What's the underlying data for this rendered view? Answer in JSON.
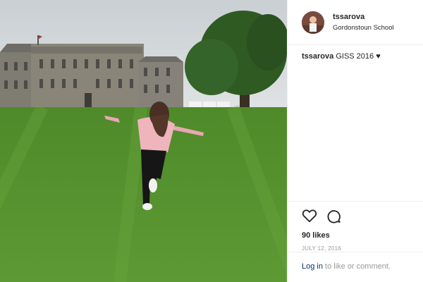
{
  "post": {
    "username": "tssarova",
    "location": "Gordonstoun School",
    "caption_user": "tssarova",
    "caption_text": "GISS 2016",
    "caption_heart": "♥",
    "likes": "90 likes",
    "date": "JULY 12, 2016"
  },
  "footer": {
    "login_label": "Log in",
    "rest_text": "to like or comment."
  },
  "icons": {
    "like": "heart-icon",
    "comment": "comment-icon"
  },
  "colors": {
    "link": "#003569",
    "muted": "#999999",
    "text": "#262626"
  }
}
